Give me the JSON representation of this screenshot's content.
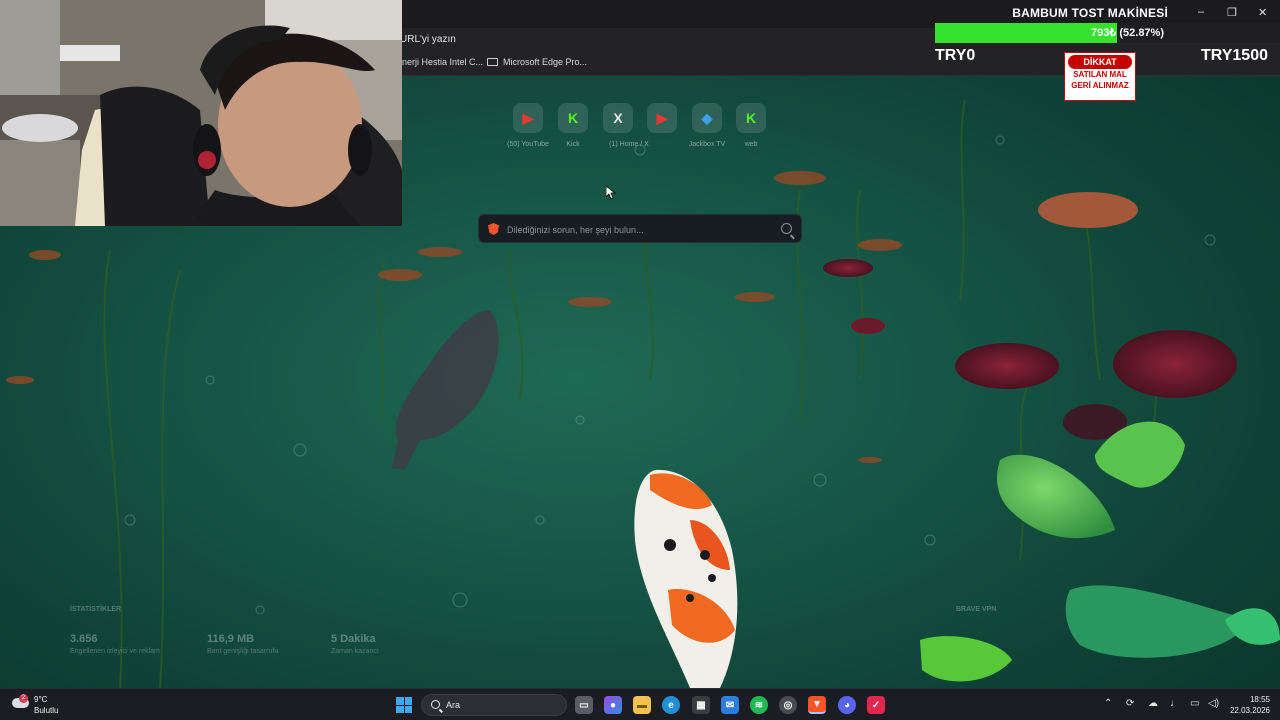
{
  "browser": {
    "address_placeholder": "URL'yi yazın",
    "bookmarks": [
      {
        "label": "nerji Hestia Intel C..."
      },
      {
        "label": "Microsoft Edge Pro..."
      }
    ]
  },
  "overlay": {
    "goal_title": "BAMBUM TOST MAKİNESİ",
    "progress_text": "793₺ (52.87%)",
    "progress_fraction": 0.5287,
    "min_label": "TRY0",
    "max_label": "TRY1500",
    "warning_badge": "DİKKAT",
    "warning_line1": "SATILAN MAL",
    "warning_line2": "GERİ ALINMAZ",
    "window_controls": [
      "–",
      "❐",
      "✕"
    ],
    "colors": {
      "progress_fill": "#37e22c",
      "warning_red": "#c40000"
    }
  },
  "newtab": {
    "shortcuts": [
      {
        "icon": "youtube-icon",
        "label": "(50) YouTube",
        "color": "#e53935"
      },
      {
        "icon": "kick-icon",
        "label": "Kick",
        "color": "#53fc18"
      },
      {
        "icon": "x-icon",
        "label": "(1) Home / X",
        "color": "#e6e6e6"
      },
      {
        "icon": "youtube-icon",
        "label": "",
        "color": "#e53935"
      },
      {
        "icon": "jackbox-icon",
        "label": "Jackbox TV",
        "color": "#3da0e8"
      },
      {
        "icon": "kick-icon",
        "label": "web",
        "color": "#53fc18"
      }
    ],
    "search_placeholder": "Dilediğinizi sorun, her şeyi bulun...",
    "stats_title": "İSTATİSTİKLER",
    "stats": [
      {
        "value": "3.656",
        "label": "Engellenen izleyici ve reklam"
      },
      {
        "value": "116,9 MB",
        "label": "Bant genişliği tasarrufu"
      },
      {
        "value": "5 Dakika",
        "label": "Zaman kazancı"
      }
    ],
    "news_title": "BRAVE VPN"
  },
  "taskbar": {
    "weather_temp": "9°C",
    "weather_cond": "Bulutlu",
    "weather_badge": "2",
    "search_label": "Ara",
    "time": "18:55",
    "date": "22.03.2026"
  }
}
